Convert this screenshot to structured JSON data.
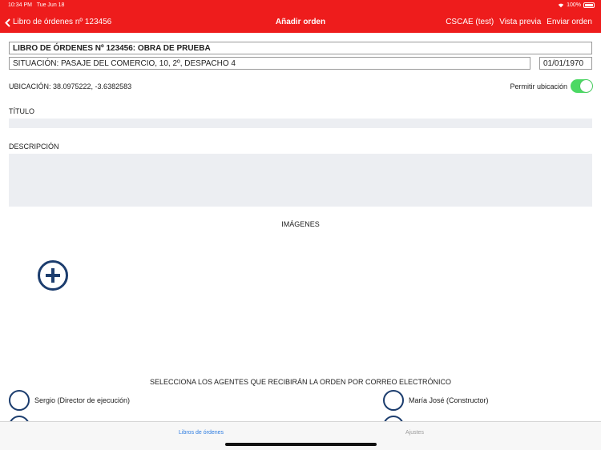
{
  "status_bar": {
    "time": "10:34 PM",
    "date": "Tue Jun 18",
    "battery": "100%"
  },
  "nav": {
    "back_label": "Libro de órdenes nº 123456",
    "title": "Añadir orden",
    "actions": [
      "CSCAE (test)",
      "Vista previa",
      "Enviar orden"
    ]
  },
  "form": {
    "book": "LIBRO DE ÓRDENES Nº 123456: OBRA DE PRUEBA",
    "situation": "SITUACIÓN: PASAJE DEL COMERCIO, 10, 2º, DESPACHO 4",
    "date": "01/01/1970",
    "location": "UBICACIÓN: 38.0975222, -3.6382583",
    "allow_location_label": "Permitir ubicación",
    "allow_location_on": true,
    "title_label": "TÍTULO",
    "title_value": "",
    "description_label": "DESCRIPCIÓN",
    "description_value": "",
    "images_label": "IMÁGENES",
    "agents_label": "SELECCIONA LOS AGENTES QUE RECIBIRÁN LA ORDEN POR CORREO ELECTRÓNICO",
    "agents": [
      "Sergio (Director de ejecución)",
      "María José (Constructor)"
    ]
  },
  "tabs": [
    "Libros de órdenes",
    "Ajustes"
  ],
  "colors": {
    "brand": "#ee1c1c",
    "accent": "#1c3d6e",
    "toggle": "#4cd964",
    "tab_active": "#2f7de1"
  }
}
